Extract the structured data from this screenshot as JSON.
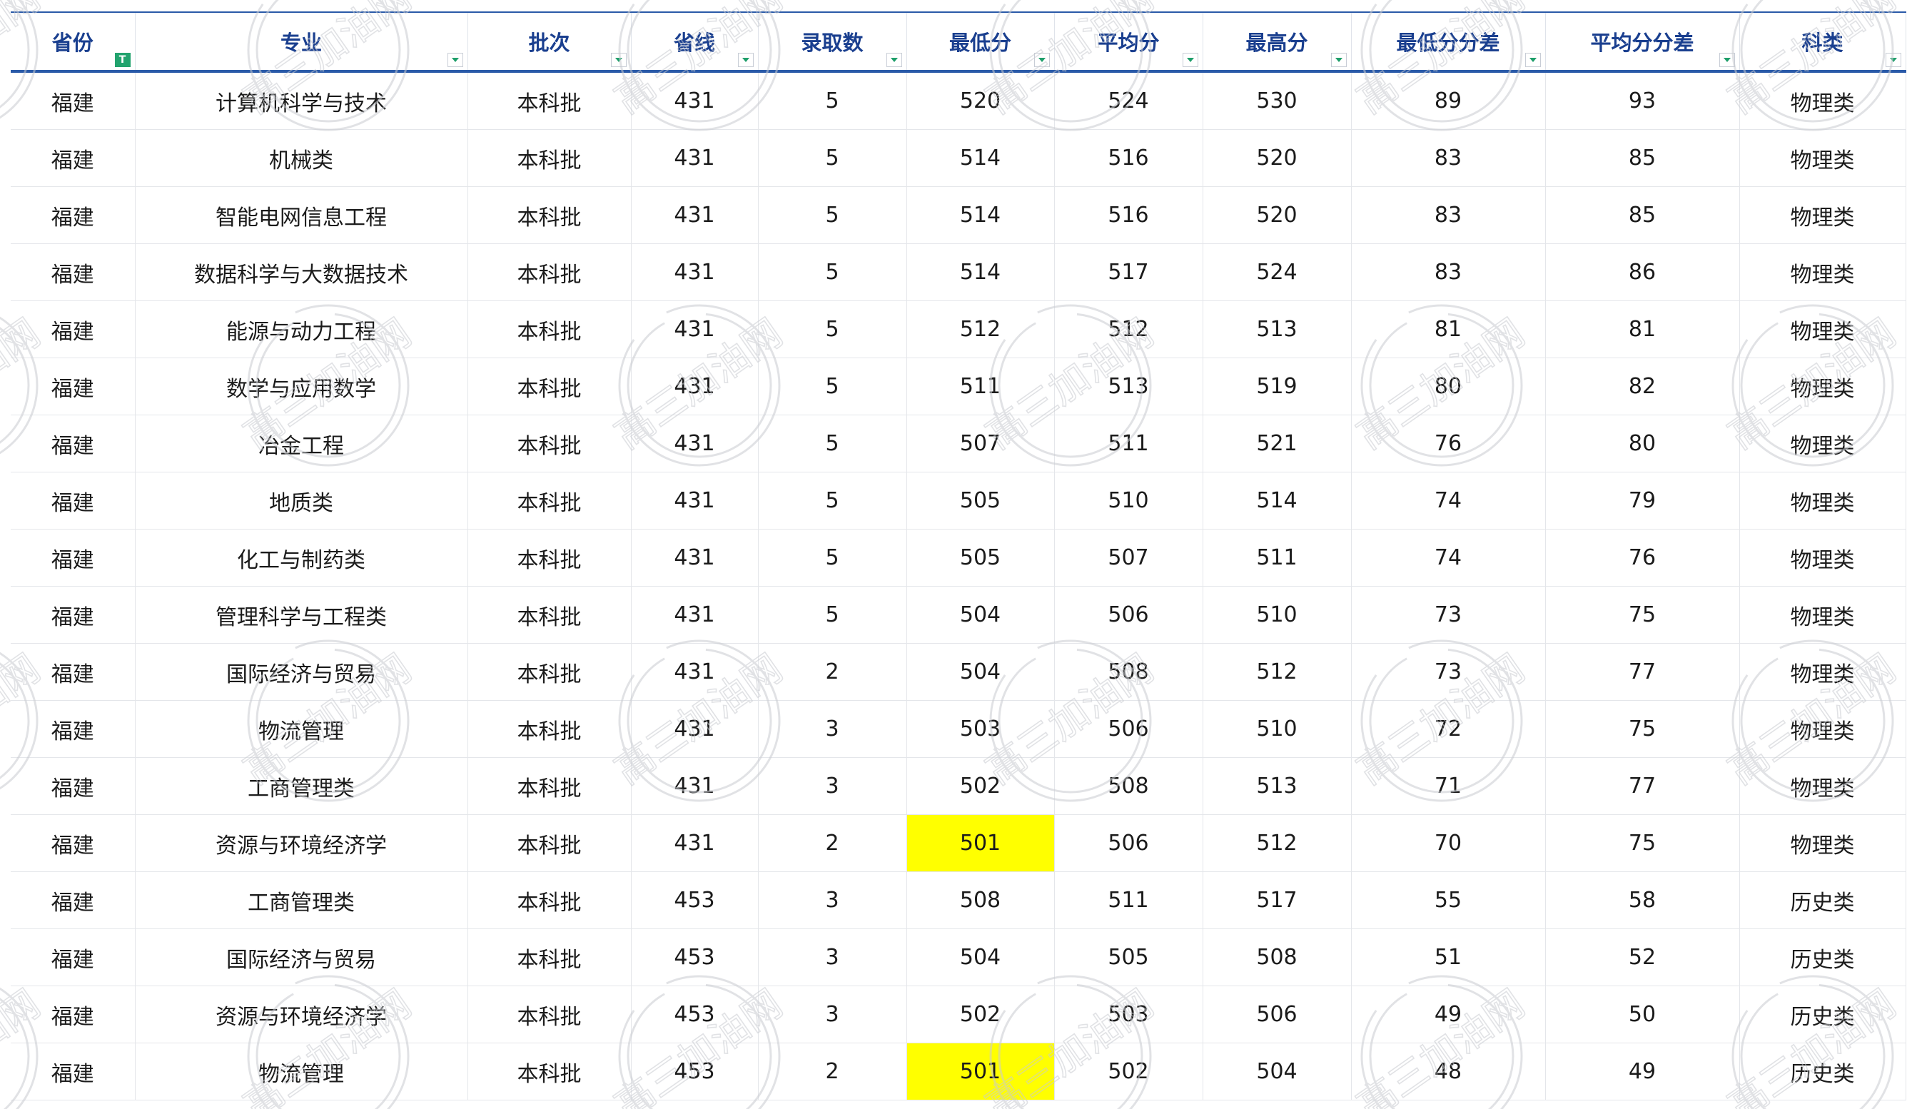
{
  "table": {
    "columns": [
      "省份",
      "专业",
      "批次",
      "省线",
      "录取数",
      "最低分",
      "平均分",
      "最高分",
      "最低分分差",
      "平均分分差",
      "科类"
    ],
    "active_filter_glyph": "T",
    "rows": [
      [
        "福建",
        "计算机科学与技术",
        "本科批",
        "431",
        "5",
        "520",
        "524",
        "530",
        "89",
        "93",
        "物理类"
      ],
      [
        "福建",
        "机械类",
        "本科批",
        "431",
        "5",
        "514",
        "516",
        "520",
        "83",
        "85",
        "物理类"
      ],
      [
        "福建",
        "智能电网信息工程",
        "本科批",
        "431",
        "5",
        "514",
        "516",
        "520",
        "83",
        "85",
        "物理类"
      ],
      [
        "福建",
        "数据科学与大数据技术",
        "本科批",
        "431",
        "5",
        "514",
        "517",
        "524",
        "83",
        "86",
        "物理类"
      ],
      [
        "福建",
        "能源与动力工程",
        "本科批",
        "431",
        "5",
        "512",
        "512",
        "513",
        "81",
        "81",
        "物理类"
      ],
      [
        "福建",
        "数学与应用数学",
        "本科批",
        "431",
        "5",
        "511",
        "513",
        "519",
        "80",
        "82",
        "物理类"
      ],
      [
        "福建",
        "冶金工程",
        "本科批",
        "431",
        "5",
        "507",
        "511",
        "521",
        "76",
        "80",
        "物理类"
      ],
      [
        "福建",
        "地质类",
        "本科批",
        "431",
        "5",
        "505",
        "510",
        "514",
        "74",
        "79",
        "物理类"
      ],
      [
        "福建",
        "化工与制药类",
        "本科批",
        "431",
        "5",
        "505",
        "507",
        "511",
        "74",
        "76",
        "物理类"
      ],
      [
        "福建",
        "管理科学与工程类",
        "本科批",
        "431",
        "5",
        "504",
        "506",
        "510",
        "73",
        "75",
        "物理类"
      ],
      [
        "福建",
        "国际经济与贸易",
        "本科批",
        "431",
        "2",
        "504",
        "508",
        "512",
        "73",
        "77",
        "物理类"
      ],
      [
        "福建",
        "物流管理",
        "本科批",
        "431",
        "3",
        "503",
        "506",
        "510",
        "72",
        "75",
        "物理类"
      ],
      [
        "福建",
        "工商管理类",
        "本科批",
        "431",
        "3",
        "502",
        "508",
        "513",
        "71",
        "77",
        "物理类"
      ],
      [
        "福建",
        "资源与环境经济学",
        "本科批",
        "431",
        "2",
        "501",
        "506",
        "512",
        "70",
        "75",
        "物理类"
      ],
      [
        "福建",
        "工商管理类",
        "本科批",
        "453",
        "3",
        "508",
        "511",
        "517",
        "55",
        "58",
        "历史类"
      ],
      [
        "福建",
        "国际经济与贸易",
        "本科批",
        "453",
        "3",
        "504",
        "505",
        "508",
        "51",
        "52",
        "历史类"
      ],
      [
        "福建",
        "资源与环境经济学",
        "本科批",
        "453",
        "3",
        "502",
        "503",
        "506",
        "49",
        "50",
        "历史类"
      ],
      [
        "福建",
        "物流管理",
        "本科批",
        "453",
        "2",
        "501",
        "502",
        "504",
        "48",
        "49",
        "历史类"
      ]
    ],
    "highlighted_cells": [
      [
        13,
        5
      ],
      [
        17,
        5
      ]
    ],
    "highlight_color": "#ffff00"
  },
  "watermark": {
    "text": "高三加油网",
    "color": "#c9ccd1"
  },
  "colors": {
    "header_text": "#1a3f8f",
    "header_rule": "#2a5aa8",
    "filter_accent": "#22a36e"
  }
}
